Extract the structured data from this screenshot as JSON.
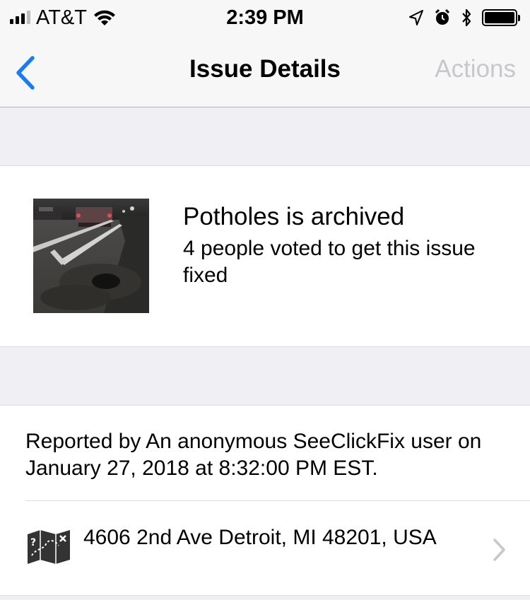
{
  "status_bar": {
    "carrier": "AT&T",
    "time": "2:39 PM"
  },
  "nav": {
    "title": "Issue Details",
    "actions_label": "Actions",
    "back_icon": "chevron-left-icon",
    "accent_color": "#1a7cf3",
    "disabled_color": "#c7c7cc"
  },
  "issue": {
    "title": "Potholes is archived",
    "votes_text": "4 people voted to get this issue fixed"
  },
  "report": {
    "reported_text": "Reported by An anonymous SeeClickFix user on January 27, 2018 at 8:32:00 PM EST.",
    "address": "4606 2nd Ave Detroit, MI 48201, USA",
    "address_icon": "map-icon"
  }
}
